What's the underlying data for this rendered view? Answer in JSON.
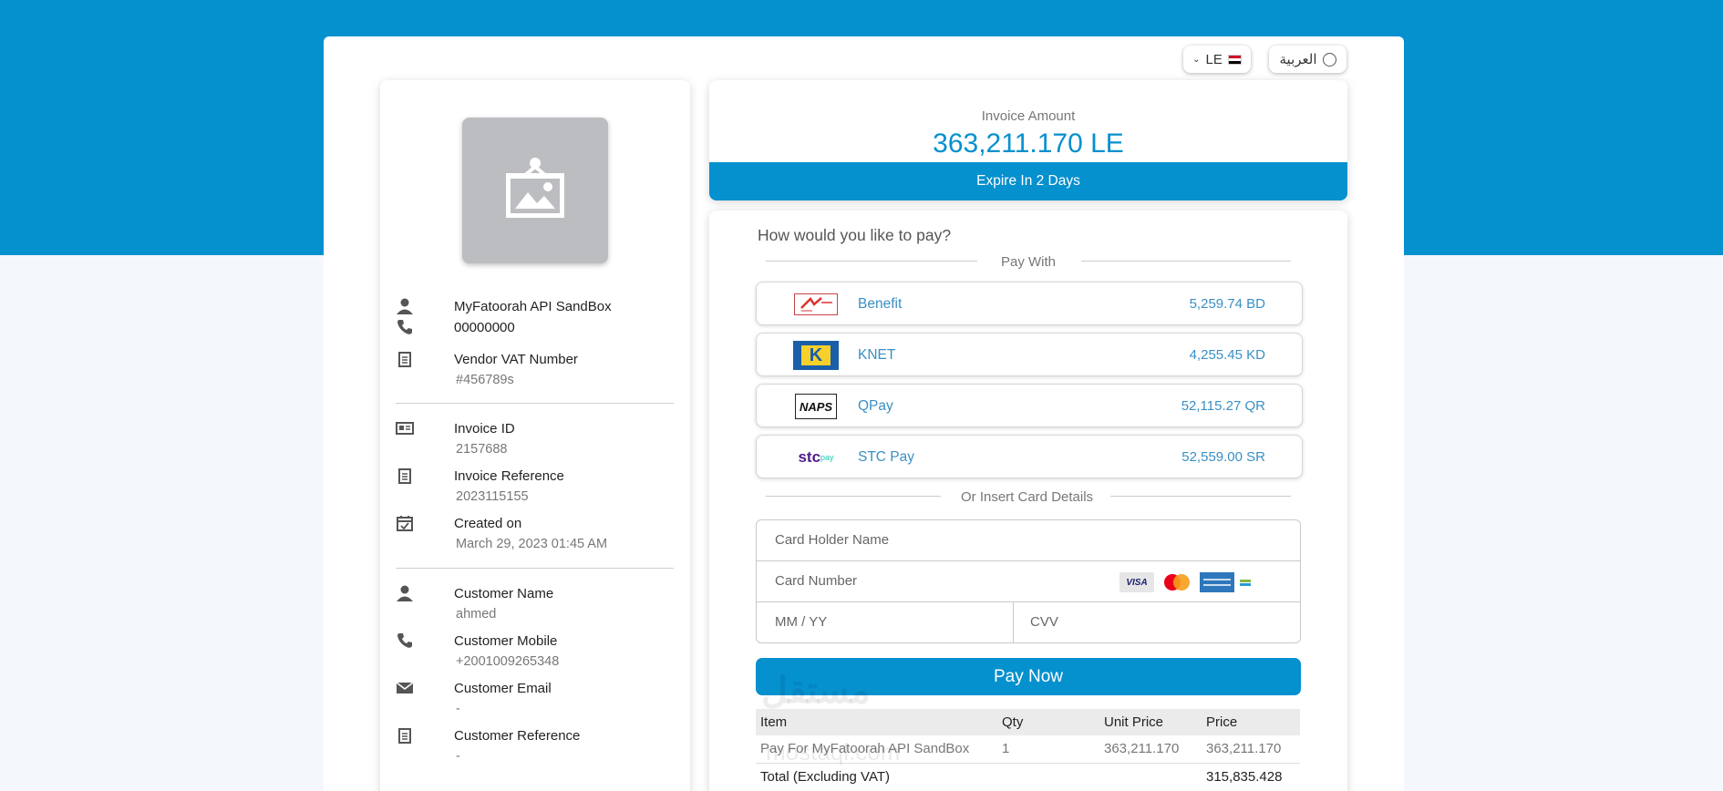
{
  "language": {
    "currency_label": "LE",
    "arabic_label": "العربية"
  },
  "vendor": {
    "name": "MyFatoorah API SandBox",
    "phone": "00000000",
    "vat_label": "Vendor VAT Number",
    "vat_value": "#456789s"
  },
  "invoice": {
    "id_label": "Invoice ID",
    "id_value": "2157688",
    "ref_label": "Invoice Reference",
    "ref_value": "2023115155",
    "created_label": "Created on",
    "created_value": "March 29, 2023 01:45 AM"
  },
  "customer": {
    "name_label": "Customer Name",
    "name_value": "ahmed",
    "mobile_label": "Customer Mobile",
    "mobile_value": "+2001009265348",
    "email_label": "Customer Email",
    "email_value": "-",
    "ref_label": "Customer Reference",
    "ref_value": "-"
  },
  "amount": {
    "label": "Invoice Amount",
    "value": "363,211.170 LE",
    "expire": "Expire In 2 Days"
  },
  "payment": {
    "question": "How would you like to pay?",
    "pay_with": "Pay With",
    "methods": [
      {
        "name": "Benefit",
        "amount": "5,259.74 BD",
        "logo_icon": "benefit-logo"
      },
      {
        "name": "KNET",
        "amount": "4,255.45 KD",
        "logo_icon": "knet-logo",
        "logo_text": "K"
      },
      {
        "name": "QPay",
        "amount": "52,115.27 QR",
        "logo_icon": "naps-logo",
        "logo_text": "NAPS"
      },
      {
        "name": "STC Pay",
        "amount": "52,559.00 SR",
        "logo_icon": "stc-pay-logo",
        "logo_text": "stc",
        "logo_sup": "pay"
      }
    ],
    "insert_card": "Or Insert Card Details",
    "card_holder_placeholder": "Card Holder Name",
    "card_number_placeholder": "Card Number",
    "expiry_placeholder": "MM / YY",
    "cvv_placeholder": "CVV",
    "card_brands": [
      "VISA",
      "mastercard",
      "amex",
      "mada"
    ],
    "pay_now": "Pay Now"
  },
  "items_table": {
    "headers": [
      "Item",
      "Qty",
      "Unit Price",
      "Price"
    ],
    "rows": [
      [
        "Pay For MyFatoorah API SandBox",
        "1",
        "363,211.170",
        "363,211.170"
      ]
    ],
    "total_label": "Total (Excluding VAT)",
    "total_value": "315,835.428"
  },
  "watermark": {
    "arabic": "مستقل",
    "latin": "mostaql.com"
  },
  "colors": {
    "primary": "#0590ce",
    "background": "#f4f8fc",
    "link": "#3a8fc4"
  }
}
